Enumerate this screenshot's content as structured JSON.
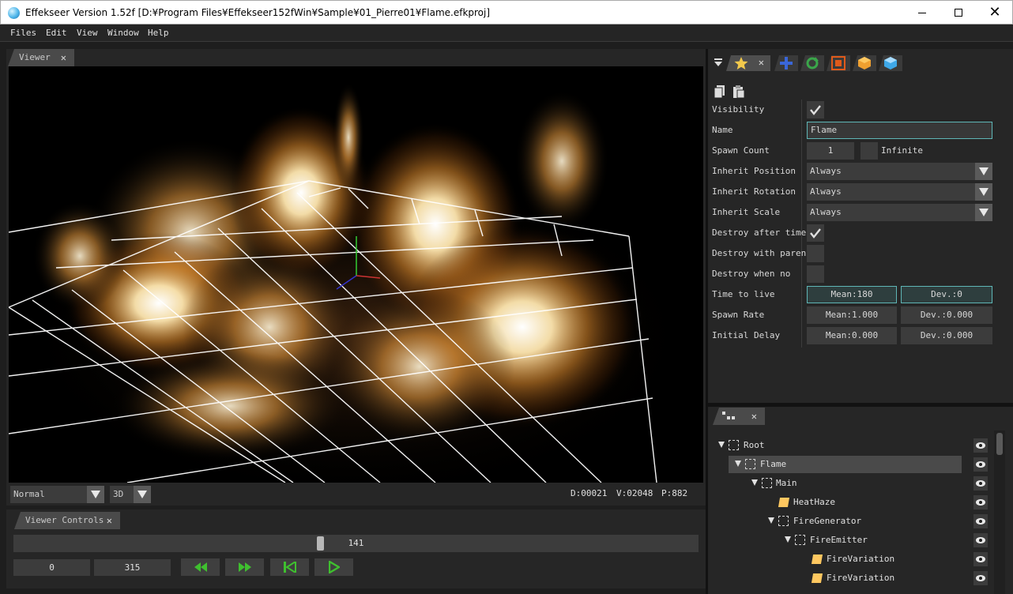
{
  "window": {
    "title": "Effekseer Version 1.52f [D:¥Program Files¥Effekseer152fWin¥Sample¥01_Pierre01¥Flame.efkproj]"
  },
  "menu": [
    "Files",
    "Edit",
    "View",
    "Window",
    "Help"
  ],
  "viewer": {
    "tab_label": "Viewer",
    "close_glyph": "✕",
    "render_mode": "Normal",
    "view_mode": "3D",
    "stats": {
      "draw": "D:00021",
      "vertex": "V:02048",
      "particles": "P:882"
    }
  },
  "viewer_controls": {
    "tab_label": "Viewer Controls",
    "close_glyph": "✕",
    "frame_progress": 0.448,
    "current_frame": "141",
    "start_frame": "0",
    "end_frame": "315"
  },
  "properties": {
    "close_glyph": "✕",
    "visibility_label": "Visibility",
    "visibility": true,
    "name_label": "Name",
    "name_value": "Flame",
    "spawn_count_label": "Spawn Count",
    "spawn_count_value": "1",
    "infinite_label": "Infinite",
    "infinite": false,
    "inherit_position_label": "Inherit Position",
    "inherit_position_value": "Always",
    "inherit_rotation_label": "Inherit Rotation",
    "inherit_rotation_value": "Always",
    "inherit_scale_label": "Inherit Scale",
    "inherit_scale_value": "Always",
    "destroy_after_time_label": "Destroy after time",
    "destroy_after_time": true,
    "destroy_with_parent_label": "Destroy with parent",
    "destroy_with_parent": false,
    "destroy_when_no_label": "Destroy when no",
    "destroy_when_no": false,
    "time_to_live_label": "Time to live",
    "time_to_live_mean": "Mean:180",
    "time_to_live_dev": "Dev.:0",
    "spawn_rate_label": "Spawn Rate",
    "spawn_rate_mean": "Mean:1.000",
    "spawn_rate_dev": "Dev.:0.000",
    "initial_delay_label": "Initial Delay",
    "initial_delay_mean": "Mean:0.000",
    "initial_delay_dev": "Dev.:0.000",
    "tab_icons": [
      "star-icon",
      "move-icon",
      "rotate-icon",
      "scale-icon",
      "box-orange-icon",
      "box-blue-icon"
    ],
    "colors": {
      "accent": "#5fb6b6",
      "star": "#f2c94c"
    }
  },
  "node_tree": {
    "close_glyph": "✕",
    "nodes": [
      {
        "label": "Root",
        "type": "node"
      },
      {
        "label": "Flame",
        "type": "node",
        "selected": true
      },
      {
        "label": "Main",
        "type": "node"
      },
      {
        "label": "HeatHaze",
        "type": "leaf"
      },
      {
        "label": "FireGenerator",
        "type": "node"
      },
      {
        "label": "FireEmitter",
        "type": "node"
      },
      {
        "label": "FireVariation",
        "type": "leaf"
      },
      {
        "label": "FireVariation",
        "type": "leaf"
      }
    ]
  }
}
